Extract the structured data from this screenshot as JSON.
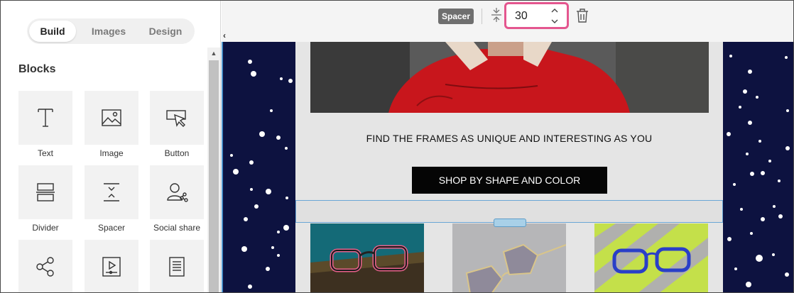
{
  "sidebar": {
    "tabs": [
      {
        "label": "Build",
        "active": true
      },
      {
        "label": "Images",
        "active": false
      },
      {
        "label": "Design",
        "active": false
      }
    ],
    "section_title": "Blocks",
    "blocks": [
      {
        "label": "Text",
        "icon": "text-icon"
      },
      {
        "label": "Image",
        "icon": "image-icon"
      },
      {
        "label": "Button",
        "icon": "button-icon"
      },
      {
        "label": "Divider",
        "icon": "divider-icon"
      },
      {
        "label": "Spacer",
        "icon": "spacer-icon"
      },
      {
        "label": "Social share",
        "icon": "social-share-icon"
      },
      {
        "label": "",
        "icon": "share-icon"
      },
      {
        "label": "",
        "icon": "video-icon"
      },
      {
        "label": "",
        "icon": "document-icon"
      }
    ]
  },
  "toolbar": {
    "block_type": "Spacer",
    "height_value": "30"
  },
  "email": {
    "headline": "FIND THE FRAMES AS UNIQUE AND INTERESTING AS YOU",
    "cta_label": "SHOP BY SHAPE AND COLOR"
  },
  "colors": {
    "accent_pink": "#e4568f",
    "canvas_bg": "#0d1240",
    "selection_blue": "#6aa6d6",
    "hero_red": "#b81218"
  }
}
